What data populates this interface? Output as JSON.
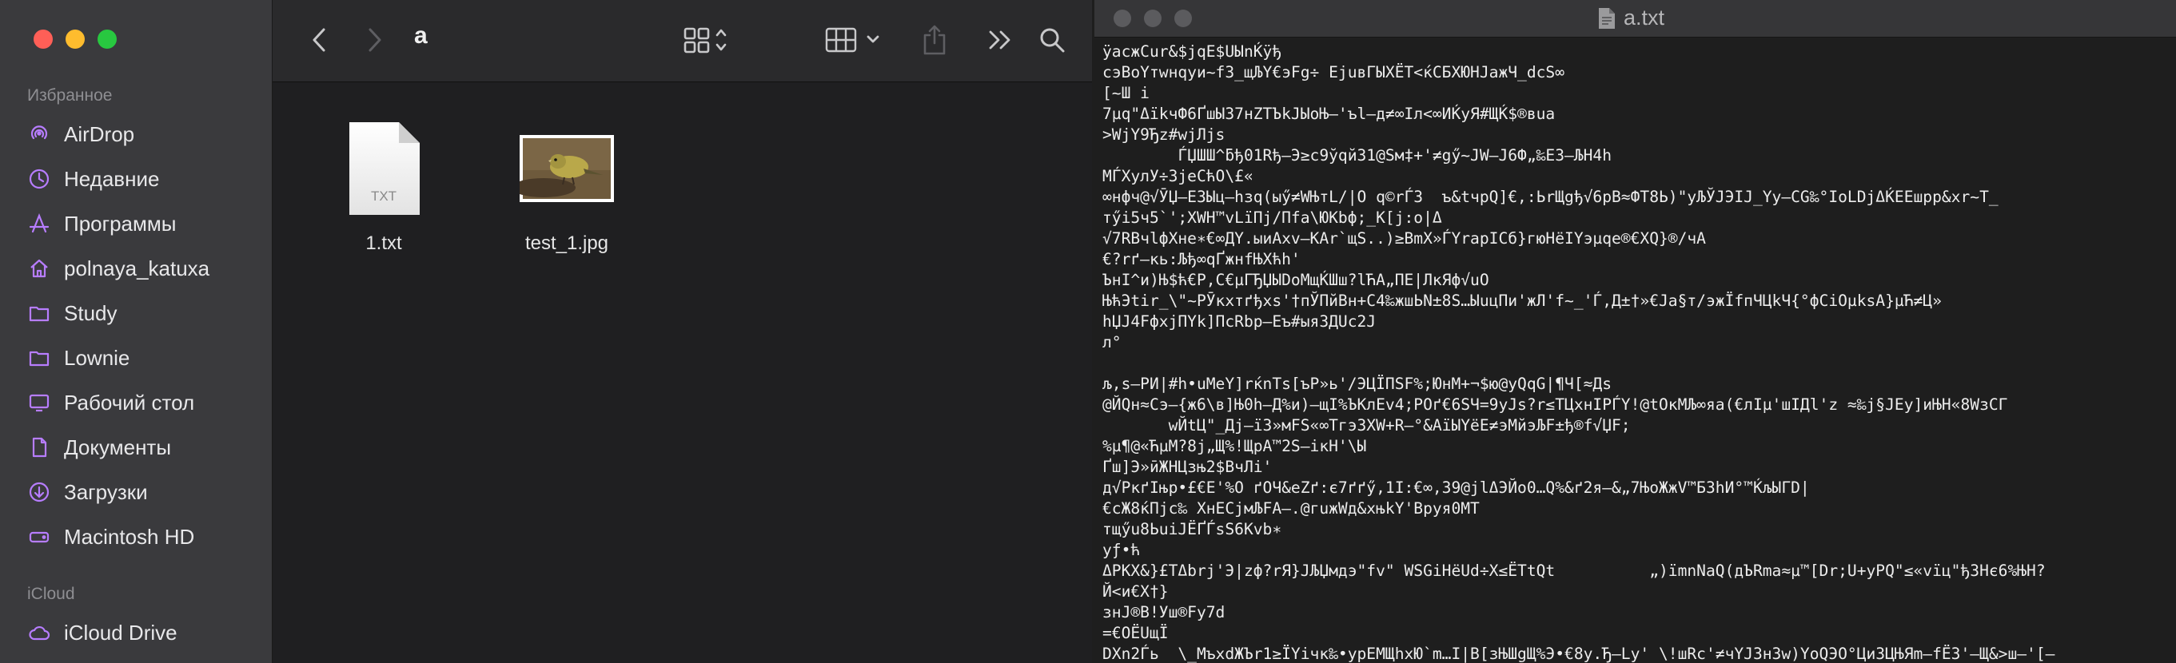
{
  "finder": {
    "sidebar": {
      "favorites_title": "Избранное",
      "favorites": [
        {
          "label": "AirDrop",
          "icon": "airdrop-icon"
        },
        {
          "label": "Недавние",
          "icon": "clock-icon"
        },
        {
          "label": "Программы",
          "icon": "applications-icon"
        },
        {
          "label": "polnaya_katuxa",
          "icon": "home-icon"
        },
        {
          "label": "Study",
          "icon": "folder-icon"
        },
        {
          "label": "Lownie",
          "icon": "folder-icon"
        },
        {
          "label": "Рабочий стол",
          "icon": "desktop-icon"
        },
        {
          "label": "Документы",
          "icon": "document-icon"
        },
        {
          "label": "Загрузки",
          "icon": "download-icon"
        },
        {
          "label": "Macintosh HD",
          "icon": "drive-icon"
        }
      ],
      "icloud_title": "iCloud",
      "icloud": [
        {
          "label": "iCloud Drive",
          "icon": "cloud-icon"
        }
      ]
    },
    "toolbar": {
      "folder_title": "a"
    },
    "files": [
      {
        "name": "1.txt",
        "icon": "txt-file-icon",
        "badge": "TXT"
      },
      {
        "name": "test_1.jpg",
        "icon": "image-thumbnail"
      }
    ]
  },
  "editor": {
    "title": "a.txt",
    "lines": [
      "ÿacжCur&$jqE$UЫnЌÿђ",
      "cэBoҮтwнqyи~f3_щЉҮ€эFg÷ EjuвГЫXЁТ<ќCБXЮHJaжЧ_dcS∞",
      "[~Ш i",
      "7µq\"ΔïkчФ6ҐшЫ37нZТЪkJЫoЊ–'ъl–д≠∞Iл<∞ИЌyЯ#ЩЌ$®вua",
      ">WjY9Ђz#wjЛjs",
      "        ЃЏШШ^ƃђ01Rђ–Э≥c9ўqй31@Sм‡+'≠gӳ~JW–J6Ф„‰E3–ЉH4h",
      "МЃXулУ÷3jeCћO\\£«",
      "∞нфч@√ӮЏ–Е3Ыц–hзq(ыӳ≠WЊтL/|O q©rЃ3  ъ&tчpQ]€,:ЬrЩgђ√6pB≈ФT8Ь)\"yЉЎJЭIJ_Yy–CG‰°IoLDjΔЌEЕшpp&xr~T_",
      "тӳi5ч5`';XWH™vLïПj/Пfa\\ЮKbф;_K[j:o|Δ",
      "√7RBчlфXнe∗€∞ДY.ыиAxv–KAr`щS..)≥BmX»ЃҮrapICб}гюHёIYэµqe®€XQ}®/чA",
      "€?rґ–кь:Љђ∞qҐжнfЊXћh'",
      "ЪнI^и)Њ$ћ€P,C€µГЂЏЫDoMщЌШш?lЋA„ПE|ЛкЯф√uO",
      "ЊћЭtir_\\\"~РӮкxтґђxs'†пЎПйBн+C4‰жшЬN±8S…ЫuцПи'жЛ'f~_'Ѓ,Д±†»€Ja§т/эжЇfпЧЦkЧ{°фCiOµksA}µЋ≠Ц»",
      "hЏJ4FфxjПYk]ПcRbp–Eъ#ыя3ДUc2J",
      "л°",
      "",
      "љ,s–РИ|#h•uMeY]rќnTs[ъP»ь'/ЭЦЇПSF%;ЮнM+¬$ю@yQqG|¶Ч[≈Дs",
      "@ЙQн≈Cэ–{ж6\\в]Њ0h–Д%и)–щI%ЪKлEv4;POґ€6SЧ=9yJs?r≤TЦxнIPЃY!@tOкMЉ∞яа(€лIµ'шIДl'z ≈‰j§JEy]иЊH«8WзCГ",
      "       wЙtЦ\"_Дj–ї3»мFS«∞Tгэ3XW+R–°&AïЫYёE≠эMйэЉF±ђ®f√ЏF;",
      "%µ¶@«ЋµM?8j„Щ%!ЩpA™2S–iкH'\\Ы",
      "Ґш]Э»ӣЖНЦзњ2$BчЛi'",
      "д√PкґIњp•£€E'%O ґОЧ&eZґ:є7ґґӳ,1I:€∞,39@jlΔЭЙo0…Q%&ґ2я–&„7ЊoЖжV™БЗhИ°™ЌљЫГD|",
      "€cЖ8ќПjс‰ XнECjмЉFA–.@гuжWд&хњkY'Врyя0МТ",
      "тщӳu8ЬuiJЁҐЃsS6Kvb∗",
      "yƒ•ћ",
      "ΔPKX&}£TΔbrj'Э|zф?rЯ}JЉЏмдэ\"fv\" WSGiHёUd÷X≤ЁTtQt          „)ïmnNaQ(дЪRma≈µ™[Dr;U+yPQ\"≤«vïц\"ђЗНє6%ЊH?",
      "Й<и€X†}",
      "знJ®B!Уш®Fy7d",
      "=€OЁUщЇ",
      "DXn2Ѓь  \\_MъxdЖЪr1≥ЇYiчк‰•урEМЩhxЮ`m…I|B[зЊШgЩ%Э•€8y.Ђ–Ly' \\!шRc'≠чYJ3н3w)YoQЭO°ЦиЗЦЊЯm–fЁЗ'–Щ&>ш–'[–"
    ]
  }
}
